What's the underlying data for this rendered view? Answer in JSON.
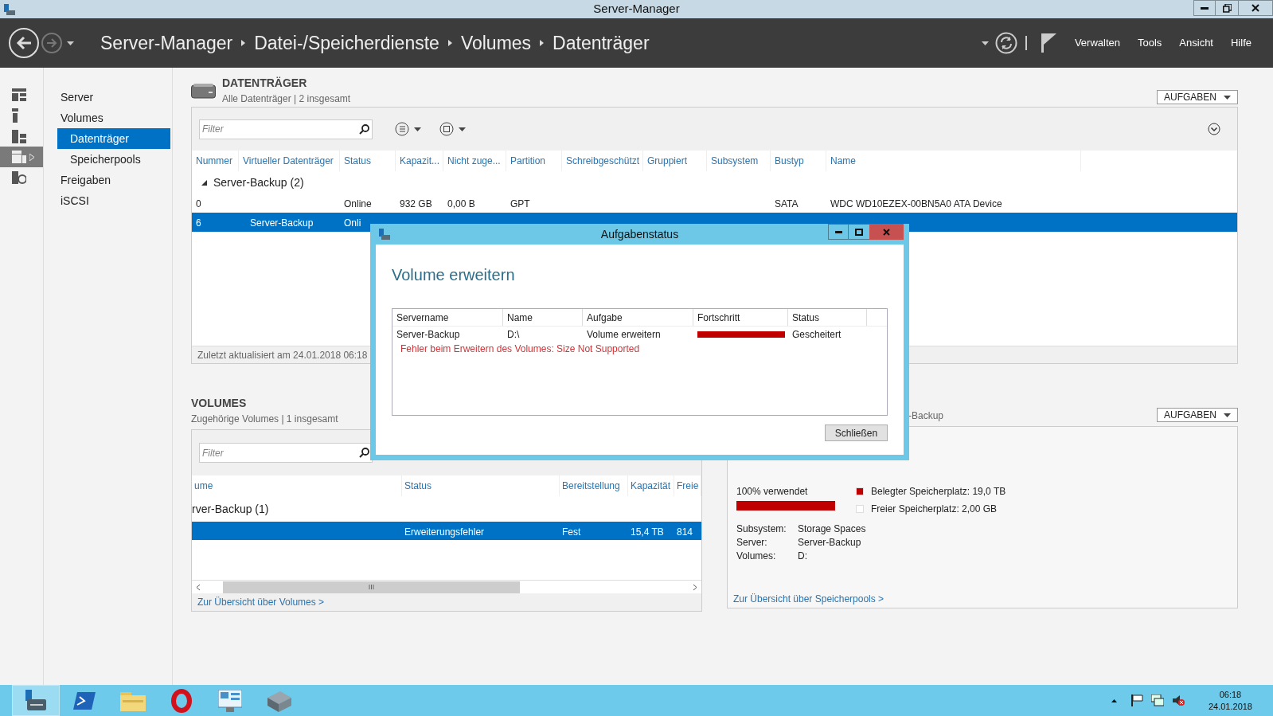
{
  "window": {
    "title": "Server-Manager"
  },
  "header": {
    "breadcrumbs": [
      "Server-Manager",
      "Datei-/Speicherdienste",
      "Volumes",
      "Datenträger"
    ],
    "menu": [
      "Verwalten",
      "Tools",
      "Ansicht",
      "Hilfe"
    ]
  },
  "strip": [
    {
      "kind": "dashboard",
      "selected": false
    },
    {
      "kind": "server",
      "selected": false
    },
    {
      "kind": "servers",
      "selected": false
    },
    {
      "kind": "files",
      "selected": true
    },
    {
      "kind": "iis",
      "selected": false
    }
  ],
  "nav": [
    {
      "label": "Server",
      "selected": false
    },
    {
      "label": "Volumes",
      "selected": false,
      "children": [
        {
          "label": "Datenträger",
          "selected": true
        },
        {
          "label": "Speicherpools",
          "selected": false
        }
      ]
    },
    {
      "label": "Freigaben",
      "selected": false
    },
    {
      "label": "iSCSI",
      "selected": false
    }
  ],
  "disks": {
    "title": "DATENTRÄGER",
    "subtitle": "Alle Datenträger | 2 insgesamt",
    "tasks": "AUFGABEN",
    "filter": {
      "placeholder": "Filter"
    },
    "columns": [
      "Nummer",
      "Virtueller Datenträger",
      "Status",
      "Kapazit...",
      "Nicht zuge...",
      "Partition",
      "Schreibgeschützt",
      "Gruppiert",
      "Subsystem",
      "Bustyp",
      "Name"
    ],
    "group": "Server-Backup (2)",
    "rows": [
      {
        "selected": false,
        "cells": [
          "0",
          "",
          "Online",
          "932 GB",
          "0,00 B",
          "GPT",
          "",
          "",
          "",
          "SATA",
          "WDC WD10EZEX-00BN5A0 ATA Device"
        ]
      },
      {
        "selected": true,
        "cells": [
          "6",
          "Server-Backup",
          "Onli"
        ]
      }
    ],
    "footer": "Zuletzt aktualisiert am 24.01.2018 06:18"
  },
  "volumes": {
    "title": "VOLUMES",
    "subtitle": "Zugehörige Volumes | 1 insgesamt",
    "filter": {
      "placeholder": "Filter"
    },
    "columns": [
      "ume",
      "Status",
      "Bereitstellung",
      "Kapazität",
      "Freie"
    ],
    "group": "rver-Backup (1)",
    "rows": [
      {
        "selected": true,
        "cells": [
          "",
          "Erweiterungsfehler",
          "Fest",
          "15,4 TB",
          "814"
        ]
      }
    ],
    "link": "Zur Übersicht über Volumes >"
  },
  "pool": {
    "subtitle": "-Backup",
    "tasks": "AUFGABEN",
    "used": "100% verwendet",
    "level": 1,
    "legend": [
      {
        "label": "Belegter Speicherplatz: 19,0 TB",
        "color": "#c00000"
      },
      {
        "label": "Freier Speicherplatz: 2,00 GB",
        "color": "#ffffff"
      }
    ],
    "details": [
      {
        "key": "Subsystem:",
        "value": "Storage Spaces"
      },
      {
        "key": "Server:",
        "value": "Server-Backup"
      },
      {
        "key": "Volumes:",
        "value": "D:"
      }
    ],
    "link": "Zur Übersicht über Speicherpools >"
  },
  "dialog": {
    "title": "Aufgabenstatus",
    "heading": "Volume erweitern",
    "columns": [
      "Servername",
      "Name",
      "Aufgabe",
      "Fortschritt",
      "Status"
    ],
    "rows": [
      {
        "server": "Server-Backup",
        "name": "D:\\",
        "task": "Volume erweitern",
        "level": 1,
        "status": "Gescheitert",
        "error": "Fehler beim Erweitern des Volumes: Size Not Supported"
      }
    ],
    "button": "Schließen"
  },
  "taskbar": {
    "time": "06:18",
    "date": "24.01.2018"
  }
}
